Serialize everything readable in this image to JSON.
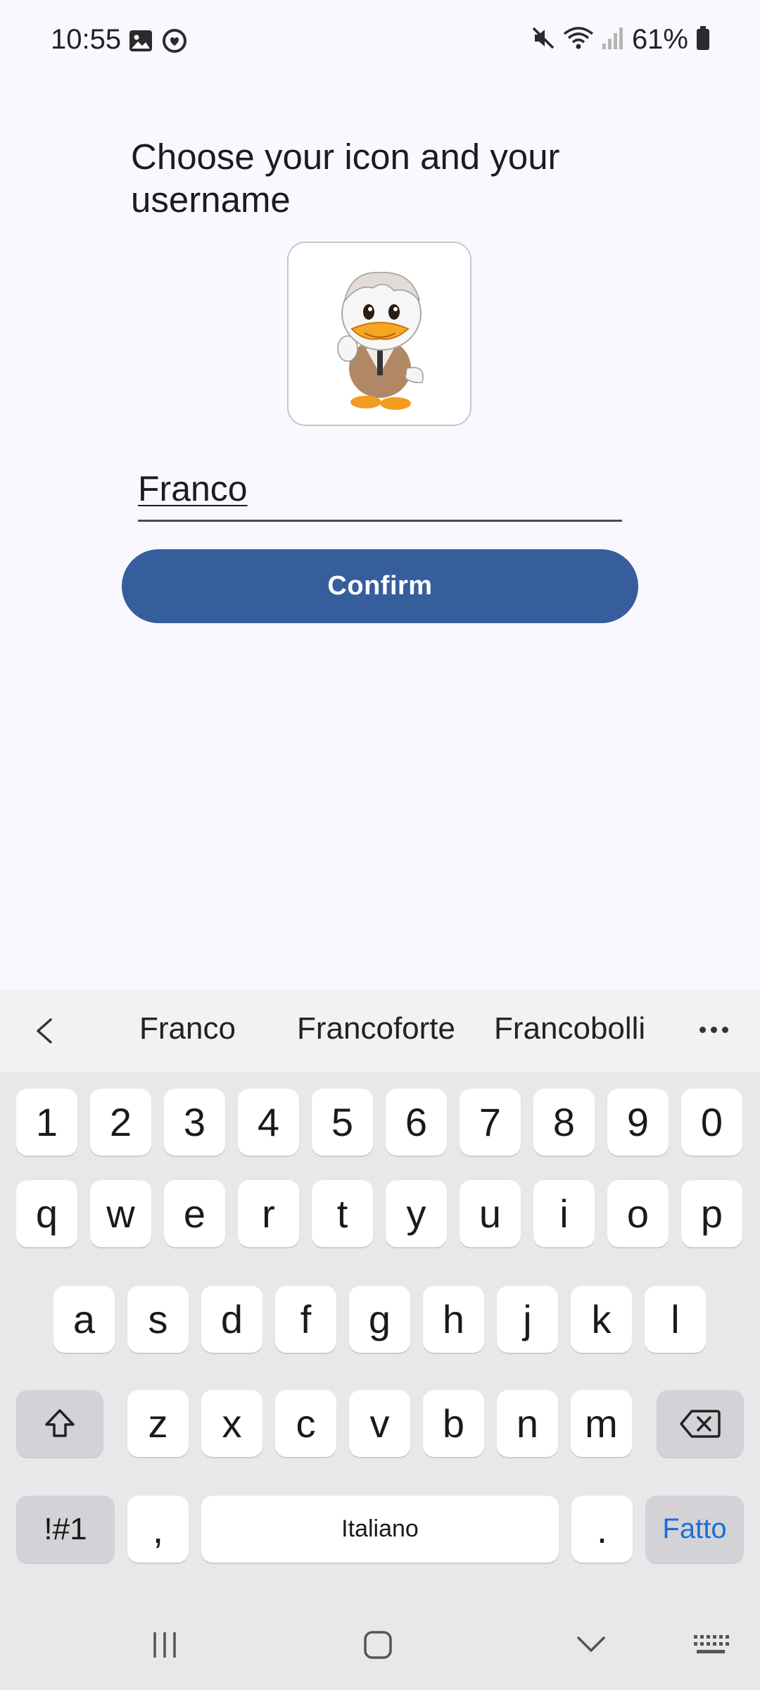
{
  "status_bar": {
    "time": "10:55",
    "battery_percent": "61%",
    "icons": [
      "gallery-notification-icon",
      "heart-app-notification-icon",
      "mute-icon",
      "wifi-icon",
      "signal-icon",
      "battery-icon"
    ]
  },
  "main": {
    "title": "Choose your icon and your username",
    "avatar_icon": "duck-avatar",
    "username_value": "Franco",
    "confirm_label": "Confirm"
  },
  "keyboard": {
    "suggestions": [
      "Franco",
      "Francoforte",
      "Francobolli"
    ],
    "row_numbers": [
      "1",
      "2",
      "3",
      "4",
      "5",
      "6",
      "7",
      "8",
      "9",
      "0"
    ],
    "row_top": [
      "q",
      "w",
      "e",
      "r",
      "t",
      "y",
      "u",
      "i",
      "o",
      "p"
    ],
    "row_middle": [
      "a",
      "s",
      "d",
      "f",
      "g",
      "h",
      "j",
      "k",
      "l"
    ],
    "row_bottom": [
      "z",
      "x",
      "c",
      "v",
      "b",
      "n",
      "m"
    ],
    "symbols_label": "!#1",
    "comma": ",",
    "space_label": "Italiano",
    "period": ".",
    "done_label": "Fatto"
  },
  "colors": {
    "accent": "#365e9d",
    "background": "#f9f8fe",
    "done_text": "#1c6ed6"
  }
}
